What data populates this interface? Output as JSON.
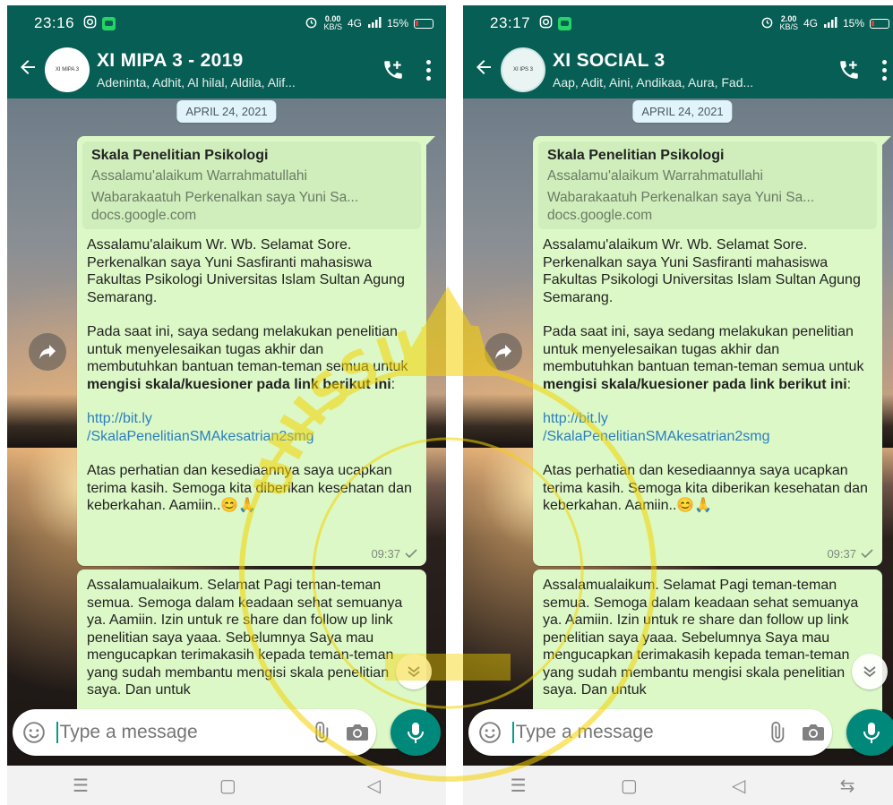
{
  "screens": [
    {
      "status": {
        "time": "23:16",
        "netspeed_value": "0.00",
        "netspeed_unit": "KB/S",
        "signal": "4G",
        "battery": "15%"
      },
      "header": {
        "title": "XI MIPA 3 - 2019",
        "subtitle": "Adeninta, Adhit, Al hilal, Aldila, Alif...",
        "avatar_text": "XI MIPA 3"
      },
      "date_chip": "APRIL 24, 2021",
      "link_preview": {
        "title": "Skala Penelitian Psikologi",
        "desc_line1": "Assalamu'alaikum Warrahmatullahi",
        "desc_line2": "Wabarakaatuh Perkenalkan saya Yuni Sa...",
        "domain": "docs.google.com"
      },
      "message1": {
        "para1": "Assalamu'alaikum Wr. Wb. Selamat Sore. Perkenalkan saya Yuni Sasfiranti mahasiswa Fakultas Psikologi  Universitas Islam Sultan Agung Semarang.",
        "para2_text": "Pada saat ini, saya sedang melakukan penelitian untuk menyelesaikan tugas akhir dan membutuhkan bantuan teman-teman semua untuk ",
        "para2_bold": "mengisi skala/kuesioner pada link berikut ini",
        "para2_end": ":",
        "link_line1": "http://bit.ly",
        "link_line2": "/SkalaPenelitianSMAkesatrian2smg",
        "para3": "Atas perhatian dan kesediaannya saya ucapkan terima kasih. Semoga kita diberikan kesehatan dan keberkahan. Aamiin..😊🙏",
        "time": "09:37"
      },
      "message2": {
        "text": "Assalamualaikum. Selamat Pagi teman-teman semua. Semoga dalam keadaan sehat semuanya ya. Aamiin. Izin untuk re share dan follow up link penelitian saya yaaa. Sebelumnya Saya mau mengucapkan terimakasih kepada teman-teman yang sudah membantu mengisi skala penelitian saya. Dan untuk"
      },
      "input": {
        "placeholder": "Type a message"
      }
    },
    {
      "status": {
        "time": "23:17",
        "netspeed_value": "2.00",
        "netspeed_unit": "KB/S",
        "signal": "4G",
        "battery": "15%"
      },
      "header": {
        "title": "XI SOCIAL 3",
        "subtitle": "Aap, Adit, Aini, Andikaa, Aura, Fad...",
        "avatar_text": "XI IPS 3"
      },
      "date_chip": "APRIL 24, 2021",
      "link_preview": {
        "title": "Skala Penelitian Psikologi",
        "desc_line1": "Assalamu'alaikum Warrahmatullahi",
        "desc_line2": "Wabarakaatuh Perkenalkan saya Yuni Sa...",
        "domain": "docs.google.com"
      },
      "message1": {
        "para1": "Assalamu'alaikum Wr. Wb. Selamat Sore. Perkenalkan saya Yuni Sasfiranti mahasiswa Fakultas Psikologi  Universitas Islam Sultan Agung Semarang.",
        "para2_text": "Pada saat ini, saya sedang melakukan penelitian untuk menyelesaikan tugas akhir dan membutuhkan bantuan teman-teman semua untuk ",
        "para2_bold": "mengisi skala/kuesioner pada link berikut ini",
        "para2_end": ":",
        "link_line1": "http://bit.ly",
        "link_line2": "/SkalaPenelitianSMAkesatrian2smg",
        "para3": "Atas perhatian dan kesediaannya saya ucapkan terima kasih. Semoga kita diberikan kesehatan dan keberkahan. Aamiin..😊🙏",
        "time": "09:37"
      },
      "message2": {
        "text": "Assalamualaikum. Selamat Pagi teman-teman semua. Semoga dalam keadaan sehat semuanya ya. Aamiin. Izin untuk re share dan follow up link penelitian saya yaaa. Sebelumnya Saya mau mengucapkan terimakasih kepada teman-teman yang sudah membantu mengisi skala penelitian saya. Dan untuk"
      },
      "input": {
        "placeholder": "Type a message"
      }
    }
  ],
  "watermark_text": "UNISSULA",
  "colors": {
    "header": "#075e54",
    "bubble": "#dcf8c6",
    "mic": "#00897b",
    "watermark": "#f5d200"
  }
}
